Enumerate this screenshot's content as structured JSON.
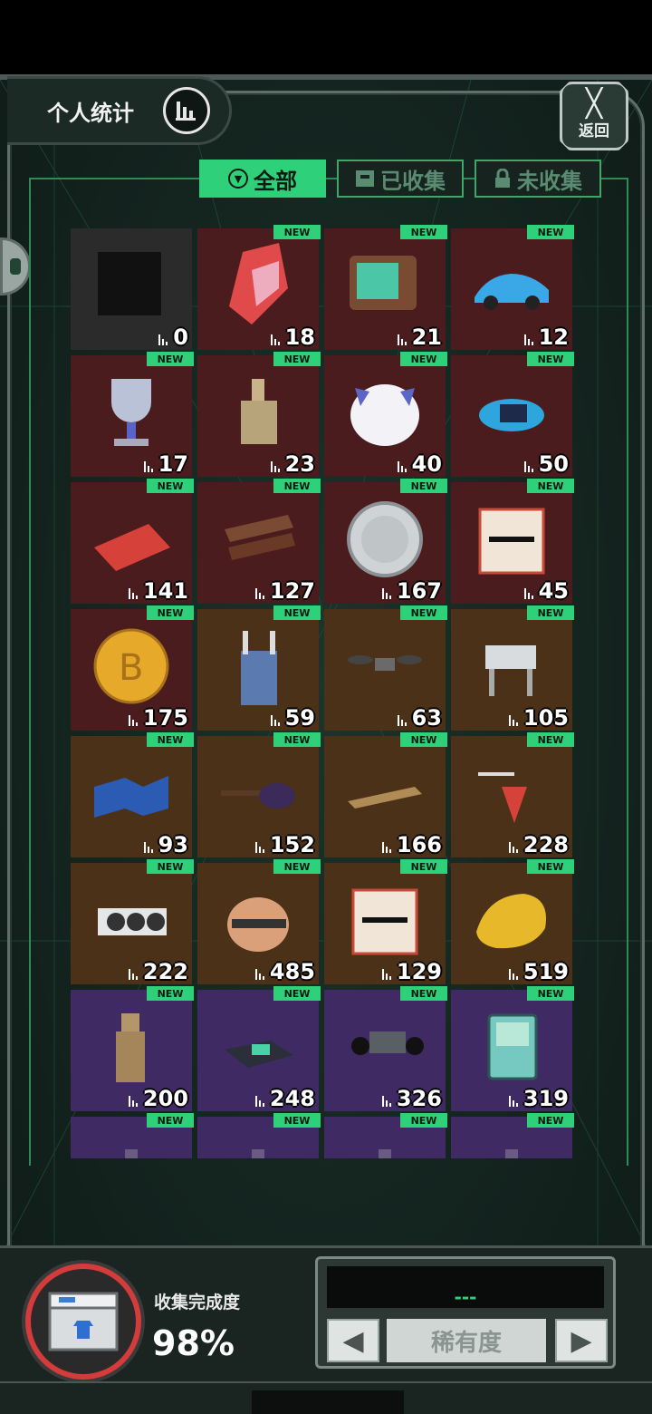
{
  "header": {
    "stats_label": "个人统计",
    "back_label": "返回"
  },
  "tabs": [
    {
      "label": "全部",
      "active": true
    },
    {
      "label": "已收集",
      "active": false
    },
    {
      "label": "未收集",
      "active": false
    }
  ],
  "badge_text": "NEW",
  "items": [
    {
      "count": "0",
      "rarity": "gray",
      "new": false,
      "icon": "silhouette-icon"
    },
    {
      "count": "18",
      "rarity": "red",
      "new": true,
      "icon": "crystal-icon"
    },
    {
      "count": "21",
      "rarity": "red",
      "new": true,
      "icon": "retro-tv-icon"
    },
    {
      "count": "12",
      "rarity": "red",
      "new": true,
      "icon": "sports-car-icon"
    },
    {
      "count": "17",
      "rarity": "red",
      "new": true,
      "icon": "trophy-cup-icon"
    },
    {
      "count": "23",
      "rarity": "red",
      "new": true,
      "icon": "dog-statue-icon"
    },
    {
      "count": "40",
      "rarity": "red",
      "new": true,
      "icon": "cat-plush-icon"
    },
    {
      "count": "50",
      "rarity": "red",
      "new": true,
      "icon": "robot-drone-icon"
    },
    {
      "count": "141",
      "rarity": "red",
      "new": true,
      "icon": "red-card-icon"
    },
    {
      "count": "127",
      "rarity": "red",
      "new": true,
      "icon": "chocolate-bar-icon"
    },
    {
      "count": "167",
      "rarity": "red",
      "new": true,
      "icon": "silver-coin-icon"
    },
    {
      "count": "45",
      "rarity": "red",
      "new": true,
      "icon": "certificate-icon"
    },
    {
      "count": "175",
      "rarity": "red",
      "new": true,
      "icon": "bitcoin-icon"
    },
    {
      "count": "59",
      "rarity": "brown",
      "new": true,
      "icon": "overalls-icon"
    },
    {
      "count": "63",
      "rarity": "brown",
      "new": true,
      "icon": "quadcopter-icon"
    },
    {
      "count": "105",
      "rarity": "brown",
      "new": true,
      "icon": "robot-dog-icon"
    },
    {
      "count": "93",
      "rarity": "brown",
      "new": true,
      "icon": "star-map-icon"
    },
    {
      "count": "152",
      "rarity": "brown",
      "new": true,
      "icon": "guitar-icon"
    },
    {
      "count": "166",
      "rarity": "brown",
      "new": true,
      "icon": "phone-icon"
    },
    {
      "count": "228",
      "rarity": "brown",
      "new": true,
      "icon": "spinning-top-icon"
    },
    {
      "count": "222",
      "rarity": "brown",
      "new": true,
      "icon": "graphics-card-icon"
    },
    {
      "count": "485",
      "rarity": "brown",
      "new": true,
      "icon": "robot-ball-icon"
    },
    {
      "count": "129",
      "rarity": "brown",
      "new": true,
      "icon": "certificate-icon"
    },
    {
      "count": "519",
      "rarity": "brown",
      "new": true,
      "icon": "gold-nugget-icon"
    },
    {
      "count": "200",
      "rarity": "purple",
      "new": true,
      "icon": "terracotta-warrior-icon"
    },
    {
      "count": "248",
      "rarity": "purple",
      "new": true,
      "icon": "game-console-icon"
    },
    {
      "count": "326",
      "rarity": "purple",
      "new": true,
      "icon": "coffin-dance-icon"
    },
    {
      "count": "319",
      "rarity": "purple",
      "new": true,
      "icon": "bmo-robot-icon"
    },
    {
      "count": "",
      "rarity": "purple",
      "new": true,
      "icon": "partial-item-icon"
    },
    {
      "count": "",
      "rarity": "purple",
      "new": true,
      "icon": "partial-item-icon"
    },
    {
      "count": "",
      "rarity": "purple",
      "new": true,
      "icon": "partial-item-icon"
    },
    {
      "count": "",
      "rarity": "purple",
      "new": true,
      "icon": "partial-item-icon"
    }
  ],
  "footer": {
    "completion_label": "收集完成度",
    "completion_value": "98%",
    "rarity_screen_text": "---",
    "rarity_label": "稀有度",
    "prev_arrow": "◀",
    "next_arrow": "▶"
  },
  "colors": {
    "accent_green": "#2ed17a",
    "rarity_gray": "#2b2b2b",
    "rarity_red": "#4b1c1d",
    "rarity_brown": "#4a3118",
    "rarity_purple": "#3f2a64"
  }
}
